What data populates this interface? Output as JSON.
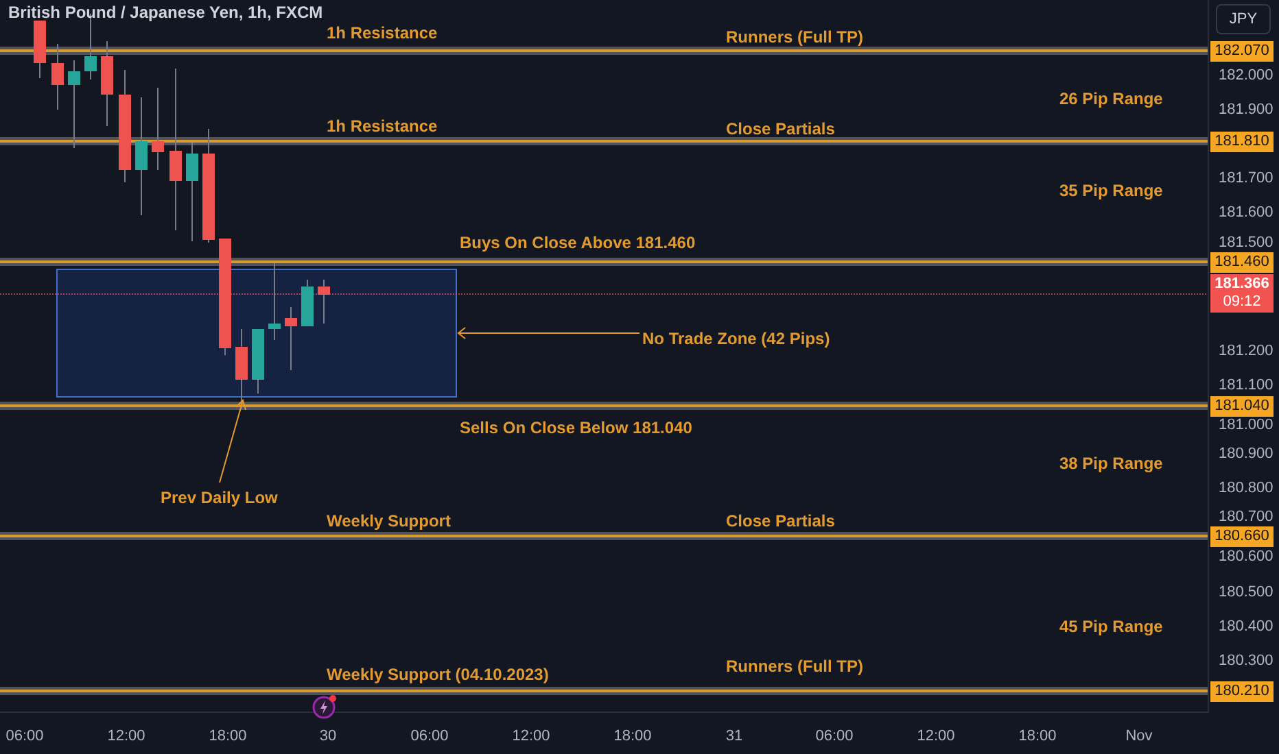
{
  "header": {
    "title": "British Pound / Japanese Yen, 1h, FXCM"
  },
  "currency_button": "JPY",
  "levels": [
    {
      "price": "182.070"
    },
    {
      "price": "181.810"
    },
    {
      "price": "181.460"
    },
    {
      "price": "181.040"
    },
    {
      "price": "180.660"
    },
    {
      "price": "180.210"
    }
  ],
  "current_price": {
    "price": "181.366",
    "countdown": "09:12"
  },
  "annotations": [
    {
      "text": "1h Resistance"
    },
    {
      "text": "Runners (Full TP)"
    },
    {
      "text": "26 Pip Range"
    },
    {
      "text": "1h Resistance"
    },
    {
      "text": "Close Partials"
    },
    {
      "text": "35 Pip Range"
    },
    {
      "text": "Buys On Close Above 181.460"
    },
    {
      "text": "No Trade Zone (42 Pips)"
    },
    {
      "text": "Sells On Close Below 181.040"
    },
    {
      "text": "38 Pip Range"
    },
    {
      "text": "Prev Daily Low"
    },
    {
      "text": "Weekly Support"
    },
    {
      "text": "Close Partials"
    },
    {
      "text": "45 Pip Range"
    },
    {
      "text": "Weekly Support (04.10.2023)"
    },
    {
      "text": "Runners (Full TP)"
    }
  ],
  "price_ticks": [
    "182.000",
    "181.900",
    "181.700",
    "181.600",
    "181.500",
    "181.200",
    "181.100",
    "181.000",
    "180.900",
    "180.800",
    "180.700",
    "180.600",
    "180.500",
    "180.400",
    "180.300"
  ],
  "time_ticks": [
    "06:00",
    "12:00",
    "18:00",
    "30",
    "06:00",
    "12:00",
    "18:00",
    "31",
    "06:00",
    "12:00",
    "18:00",
    "Nov"
  ]
}
